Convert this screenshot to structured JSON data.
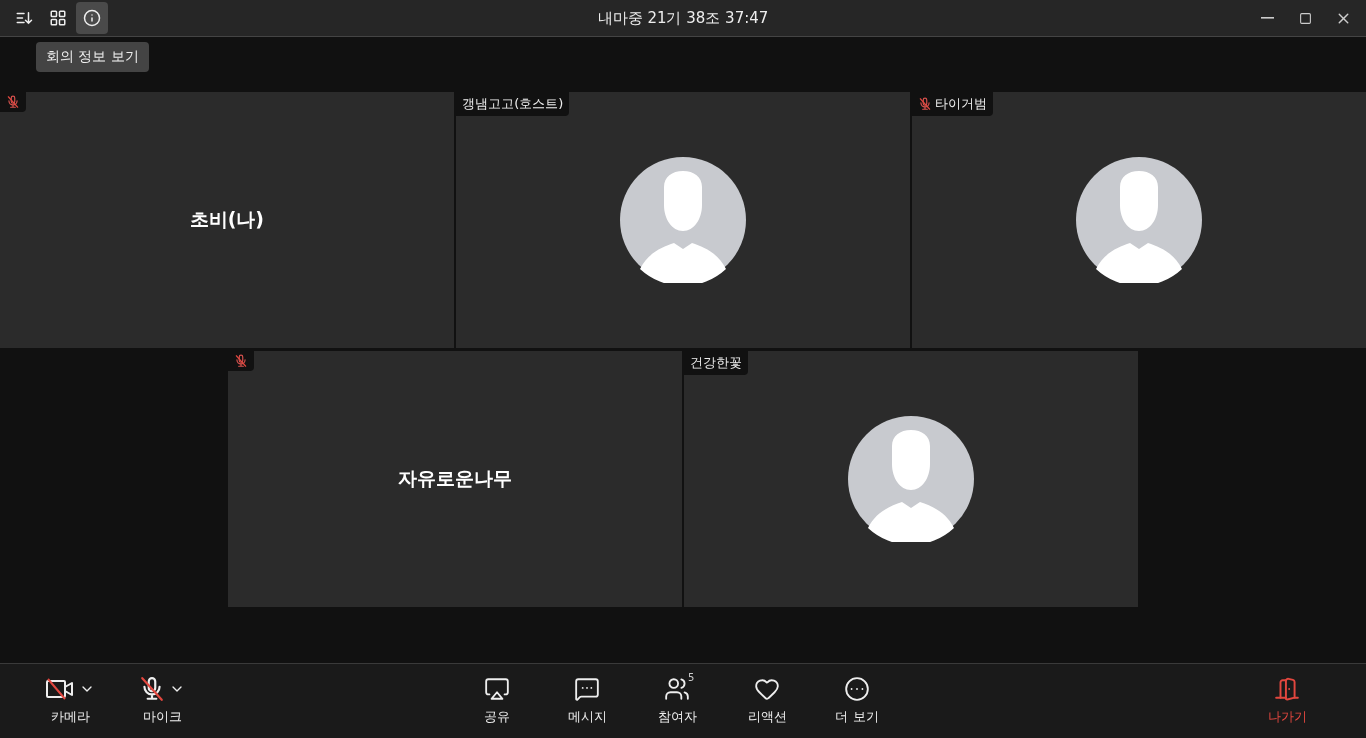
{
  "title_bar": {
    "title": "내마중 21기 38조 37:47",
    "tools": [
      {
        "kind": "sort",
        "active": false
      },
      {
        "kind": "grid",
        "active": false
      },
      {
        "kind": "info",
        "active": true
      }
    ],
    "tooltip": "회의 정보 보기"
  },
  "tiles": [
    {
      "muted": true,
      "kind": "name",
      "name": "초비(나)"
    },
    {
      "label": "갱냄고고(호스트)",
      "muted": false,
      "kind": "avatar"
    },
    {
      "label": "타이거범",
      "muted": true,
      "kind": "avatar"
    },
    {
      "muted": true,
      "kind": "name",
      "name": "자유로운나무"
    },
    {
      "label": "건강한꽃",
      "muted": false,
      "kind": "avatar"
    }
  ],
  "toolbar": {
    "left": [
      {
        "kind": "camera",
        "label": "카메라",
        "off": true
      },
      {
        "kind": "mic",
        "label": "마이크",
        "off": true
      }
    ],
    "center": [
      {
        "kind": "share",
        "label": "공유"
      },
      {
        "kind": "message",
        "label": "메시지"
      },
      {
        "kind": "participants",
        "label": "참여자",
        "badge": "5"
      },
      {
        "kind": "reaction",
        "label": "리액션"
      },
      {
        "kind": "more",
        "label": "더 보기"
      }
    ],
    "leave": {
      "label": "나가기"
    }
  }
}
